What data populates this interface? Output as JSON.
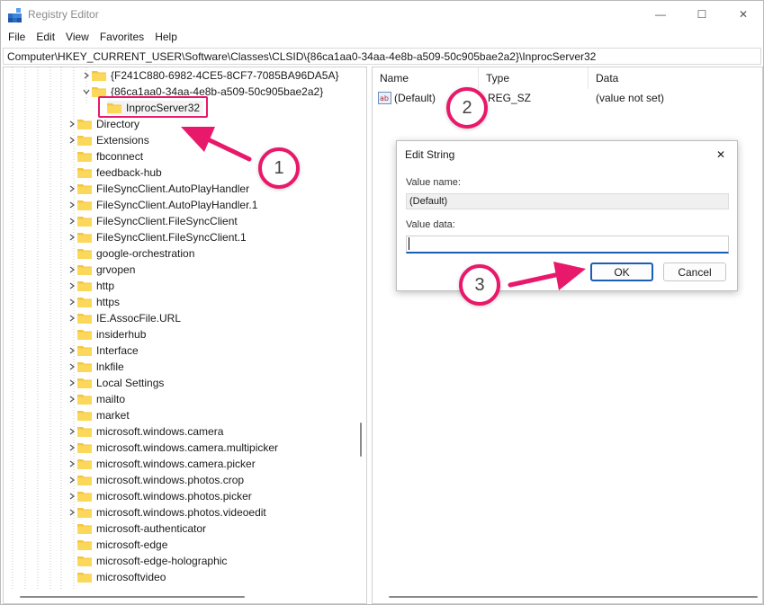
{
  "window": {
    "title": "Registry Editor",
    "minimize_glyph": "—",
    "maximize_glyph": "☐",
    "close_glyph": "✕"
  },
  "menu": [
    "File",
    "Edit",
    "View",
    "Favorites",
    "Help"
  ],
  "address": "Computer\\HKEY_CURRENT_USER\\Software\\Classes\\CLSID\\{86ca1aa0-34aa-4e8b-a509-50c905bae2a2}\\InprocServer32",
  "tree": {
    "clsid_items": [
      {
        "label": "{F241C880-6982-4CE5-8CF7-7085BA96DA5A}",
        "expanded": false
      },
      {
        "label": "{86ca1aa0-34aa-4e8b-a509-50c905bae2a2}",
        "expanded": true
      }
    ],
    "selected_child": "InprocServer32",
    "items": [
      "Directory",
      "Extensions",
      "fbconnect",
      "feedback-hub",
      "FileSyncClient.AutoPlayHandler",
      "FileSyncClient.AutoPlayHandler.1",
      "FileSyncClient.FileSyncClient",
      "FileSyncClient.FileSyncClient.1",
      "google-orchestration",
      "grvopen",
      "http",
      "https",
      "IE.AssocFile.URL",
      "insiderhub",
      "Interface",
      "lnkfile",
      "Local Settings",
      "mailto",
      "market",
      "microsoft.windows.camera",
      "microsoft.windows.camera.multipicker",
      "microsoft.windows.camera.picker",
      "microsoft.windows.photos.crop",
      "microsoft.windows.photos.picker",
      "microsoft.windows.photos.videoedit",
      "microsoft-authenticator",
      "microsoft-edge",
      "microsoft-edge-holographic",
      "microsoftvideo"
    ],
    "items_with_chevron": [
      true,
      true,
      false,
      false,
      true,
      true,
      true,
      true,
      false,
      true,
      true,
      true,
      true,
      false,
      true,
      true,
      true,
      true,
      false,
      true,
      true,
      true,
      true,
      true,
      true,
      false,
      false,
      false,
      false
    ]
  },
  "values": {
    "columns": {
      "name": "Name",
      "type": "Type",
      "data": "Data"
    },
    "rows": [
      {
        "name": "(Default)",
        "type": "REG_SZ",
        "data": "(value not set)",
        "icon": "ab"
      }
    ]
  },
  "dialog": {
    "title": "Edit String",
    "value_name_label": "Value name:",
    "value_name": "(Default)",
    "value_data_label": "Value data:",
    "value_data": "",
    "ok_label": "OK",
    "cancel_label": "Cancel",
    "close_glyph": "✕"
  },
  "annotations": {
    "step1": "1",
    "step2": "2",
    "step3": "3",
    "accent": "#e8196a"
  },
  "colors": {
    "folder": "#f4c542",
    "focus_blue": "#1a5fb4"
  }
}
